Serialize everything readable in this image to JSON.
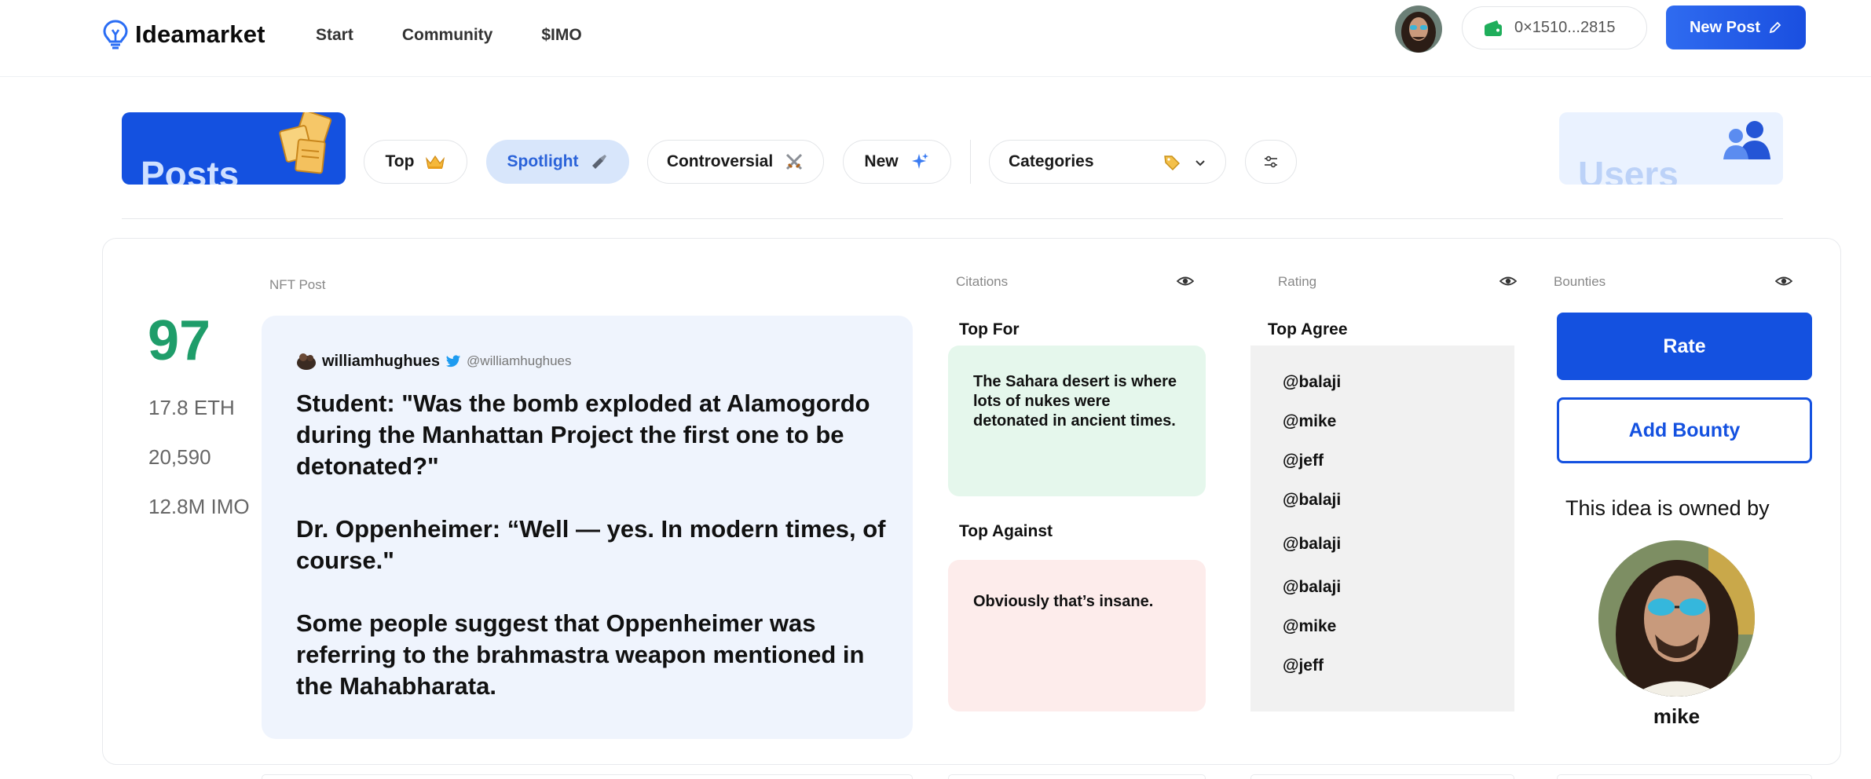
{
  "header": {
    "brand": "Ideamarket",
    "nav": [
      "Start",
      "Community",
      "$IMO"
    ],
    "wallet_address": "0×1510...2815",
    "new_post_label": "New Post"
  },
  "filters": {
    "posts_label": "Posts",
    "users_label": "Users",
    "chips": {
      "top": "Top",
      "spotlight": "Spotlight",
      "controversial": "Controversial",
      "new": "New",
      "categories": "Categories"
    },
    "active_chip": "spotlight"
  },
  "columns": {
    "nft_post": "NFT Post",
    "citations": "Citations",
    "rating": "Rating",
    "bounties": "Bounties"
  },
  "post": {
    "score": "97",
    "eth": "17.8 ETH",
    "count": "20,590",
    "imo": "12.8M IMO",
    "author_name": "williamhughues",
    "author_handle": "@williamhughues",
    "paragraphs": [
      "Student: \"Was the bomb exploded at Alamogordo during the Manhattan Project the first one to be detonated?\"",
      "Dr. Oppenheimer: “Well — yes. In modern times, of course.\"",
      "Some people suggest that Oppenheimer was referring to the brahmastra weapon mentioned in the Mahabharata."
    ]
  },
  "citations": {
    "top_for_label": "Top For",
    "top_for_text": "The Sahara desert is where lots of nukes were detonated in ancient times.",
    "top_against_label": "Top Against",
    "top_against_text": "Obviously that’s insane."
  },
  "rating": {
    "top_agree_label": "Top Agree",
    "agree": [
      "@balaji",
      "@mike",
      "@jeff",
      "@balaji",
      "@balaji",
      "@balaji",
      "@mike",
      "@jeff"
    ]
  },
  "bounties": {
    "rate_label": "Rate",
    "add_bounty_label": "Add Bounty",
    "owned_by": "This idea is owned by",
    "owner_name": "mike"
  },
  "colors": {
    "primary": "#1451e0",
    "score_green": "#1f9d6a",
    "post_bg": "#eff4fd",
    "for_bg": "#e5f7ec",
    "against_bg": "#fdeceb"
  }
}
